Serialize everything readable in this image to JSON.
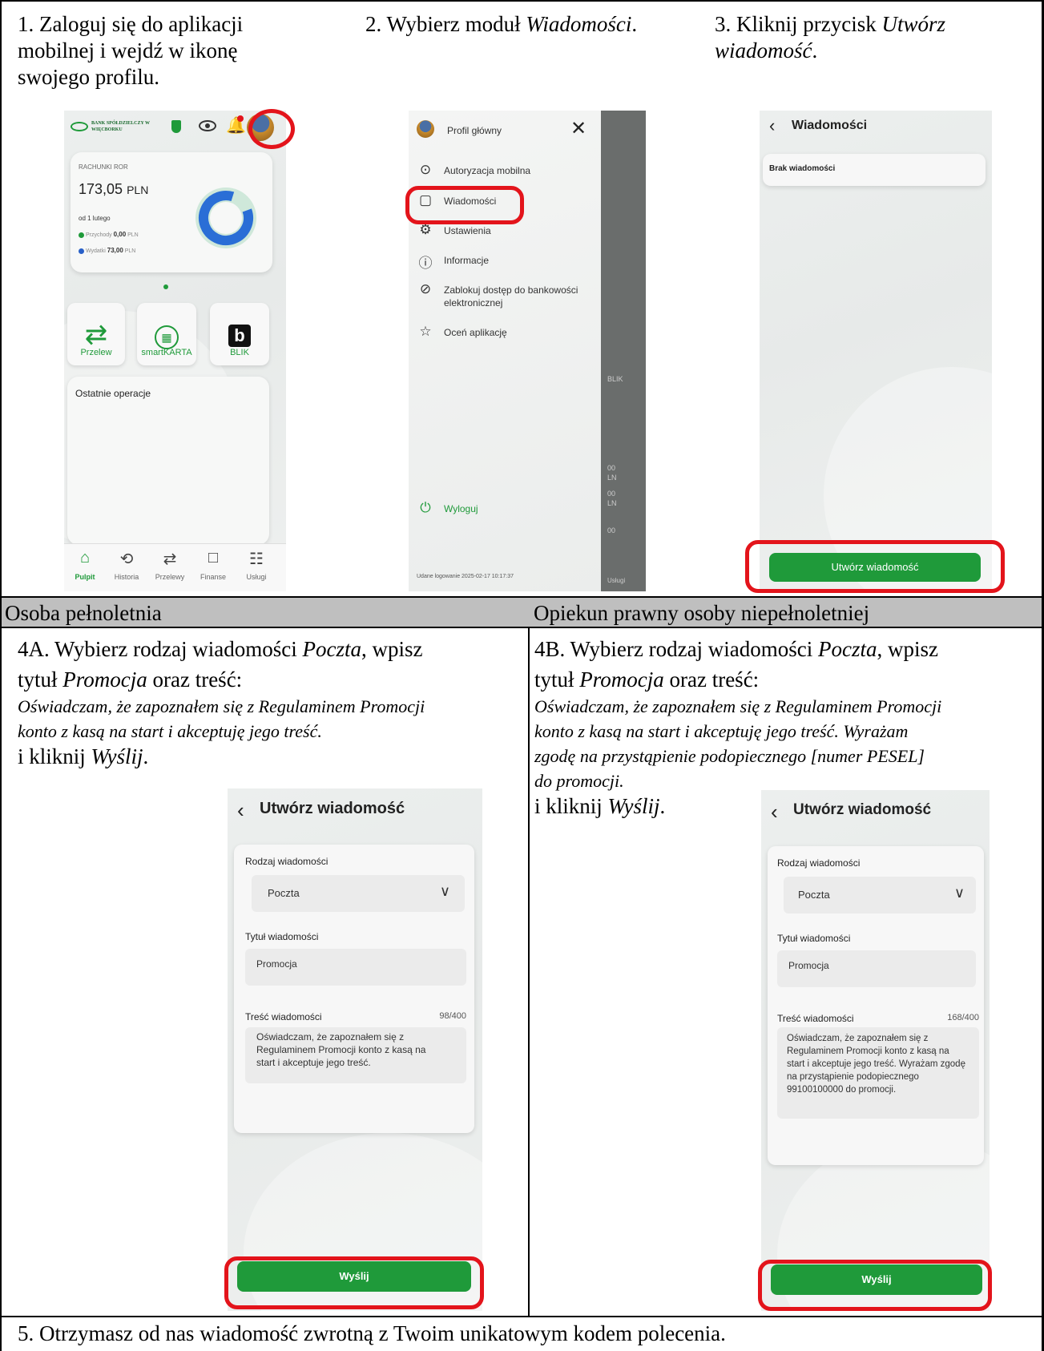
{
  "steps": {
    "step1_lines": [
      "1. Zaloguj się do aplikacji",
      "mobilnej i wejdź w ikonę",
      "swojego profilu."
    ],
    "step2_prefix": "2. Wybierz moduł ",
    "step2_em": "Wiadomości",
    "step2_suffix": ".",
    "step3_prefix": "3. Kliknij przycisk ",
    "step3_em1": "Utwórz",
    "step3_em2": "wiadomość",
    "step3_suffix": ".",
    "header_left": "Osoba pełnoletnia",
    "header_right": "Opiekun prawny osoby niepełnoletniej",
    "step4a_l1_prefix": "4A. Wybierz rodzaj wiadomości ",
    "step4a_l1_em": "Poczta",
    "step4a_l1_suffix": ", wpisz",
    "step4a_l2_prefix": "tytuł ",
    "step4a_l2_em": "Promocja",
    "step4a_l2_suffix": " oraz treść:",
    "step4a_statement": [
      "Oświadczam, że zapoznałem się z Regulaminem Promocji",
      "konto z kasą na start i akceptuję jego treść."
    ],
    "step4a_click_prefix": "i kliknij ",
    "step4a_click_em": "Wyślij",
    "step4a_click_suffix": ".",
    "step4b_l1_prefix": "4B. Wybierz rodzaj wiadomości ",
    "step4b_l1_em": "Poczta",
    "step4b_l1_suffix": ", wpisz",
    "step4b_l2_prefix": "tytuł ",
    "step4b_l2_em": "Promocja",
    "step4b_l2_suffix": " oraz treść:",
    "step4b_statement": [
      "Oświadczam, że zapoznałem się z Regulaminem Promocji",
      "konto z kasą na start i akceptuję jego treść. Wyrażam",
      "zgodę na przystąpienie podopiecznego [numer PESEL]",
      "do promocji."
    ],
    "step4b_click_prefix": "i kliknij ",
    "step4b_click_em": "Wyślij",
    "step4b_click_suffix": ".",
    "step5": "5. Otrzymasz od nas wiadomość zwrotną z Twoim unikatowym kodem polecenia."
  },
  "screen1": {
    "bank_name": "BANK SPÓŁDZIELCZY W WIĘCBORKU",
    "account_label": "RACHUNKI ROR",
    "balance": "173,05",
    "currency": "PLN",
    "period": "od 1 lutego",
    "income_label": "Przychody",
    "income_value": "0,00",
    "income_currency": "PLN",
    "expense_label": "Wydatki",
    "expense_value": "73,00",
    "expense_currency": "PLN",
    "tiles": [
      "Przelew",
      "smartKARTA",
      "BLIK"
    ],
    "recent_ops": "Ostatnie operacje",
    "nav": [
      "Pulpit",
      "Historia",
      "Przelewy",
      "Finanse",
      "Usługi"
    ]
  },
  "screen2": {
    "profile": "Profil główny",
    "items": [
      "Autoryzacja mobilna",
      "Wiadomości",
      "Ustawienia",
      "Informacje",
      "Zablokuj dostęp do bankowości elektronicznej",
      "Oceń aplikację"
    ],
    "logout": "Wyloguj",
    "last_login": "Udane logowanie 2025-02-17 10:17:37",
    "side_blik": "BLIK",
    "side_value1": "00",
    "side_value2": "00",
    "side_value3": "00",
    "side_currency": "LN",
    "side_nav": "Usługi"
  },
  "screen3": {
    "title": "Wiadomości",
    "empty": "Brak wiadomości",
    "button": "Utwórz wiadomość"
  },
  "form_a": {
    "title": "Utwórz wiadomość",
    "type_label": "Rodzaj wiadomości",
    "type_value": "Poczta",
    "subject_label": "Tytuł wiadomości",
    "subject_value": "Promocja",
    "body_label": "Treść wiadomości",
    "counter": "98/400",
    "body_lines": [
      "Oświadczam, że zapoznałem się z",
      "Regulaminem Promocji konto z kasą na",
      "start i akceptuje jego treść."
    ],
    "send": "Wyślij"
  },
  "form_b": {
    "title": "Utwórz wiadomość",
    "type_label": "Rodzaj wiadomości",
    "type_value": "Poczta",
    "subject_label": "Tytuł wiadomości",
    "subject_value": "Promocja",
    "body_label": "Treść wiadomości",
    "counter": "168/400",
    "body_lines": [
      "Oświadczam, że zapoznałem się z",
      "Regulaminem Promocji konto z kasą na",
      "start i akceptuje jego treść. Wyrażam zgodę",
      "na przystąpienie podopiecznego",
      "99100100000 do promocji."
    ],
    "send": "Wyślij"
  },
  "colors": {
    "accent_green": "#1f9a3a",
    "highlight_red": "#e3141b",
    "header_gray": "#bfbfbf"
  }
}
